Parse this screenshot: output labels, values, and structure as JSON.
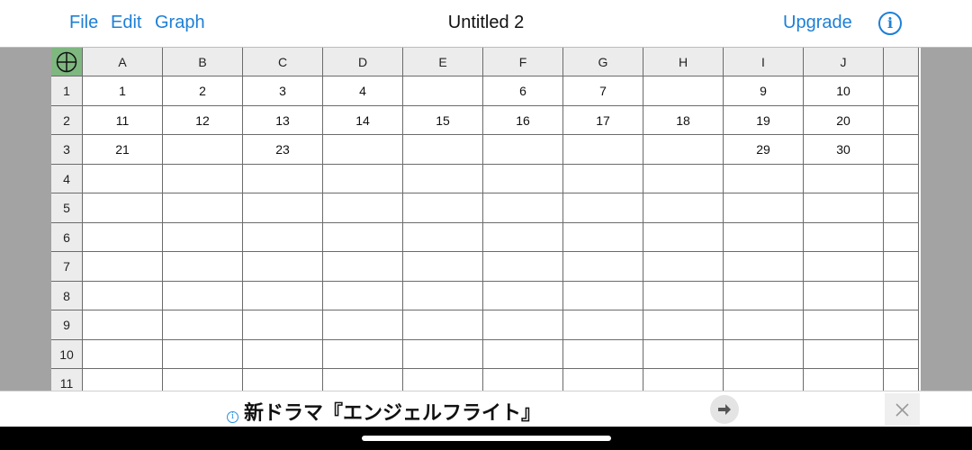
{
  "menu": {
    "file": "File",
    "edit": "Edit",
    "graph": "Graph"
  },
  "document": {
    "title": "Untitled 2"
  },
  "actions": {
    "upgrade": "Upgrade",
    "info_symbol": "i"
  },
  "spreadsheet": {
    "columns": [
      "A",
      "B",
      "C",
      "D",
      "E",
      "F",
      "G",
      "H",
      "I",
      "J",
      ""
    ],
    "row_numbers": [
      "1",
      "2",
      "3",
      "4",
      "5",
      "6",
      "7",
      "8",
      "9",
      "10",
      "11"
    ],
    "cells": [
      [
        "1",
        "2",
        "3",
        "4",
        "",
        "6",
        "7",
        "",
        "9",
        "10",
        ""
      ],
      [
        "11",
        "12",
        "13",
        "14",
        "15",
        "16",
        "17",
        "18",
        "19",
        "20",
        ""
      ],
      [
        "21",
        "",
        "23",
        "",
        "",
        "",
        "",
        "",
        "29",
        "30",
        ""
      ],
      [
        "",
        "",
        "",
        "",
        "",
        "",
        "",
        "",
        "",
        "",
        ""
      ],
      [
        "",
        "",
        "",
        "",
        "",
        "",
        "",
        "",
        "",
        "",
        ""
      ],
      [
        "",
        "",
        "",
        "",
        "",
        "",
        "",
        "",
        "",
        "",
        ""
      ],
      [
        "",
        "",
        "",
        "",
        "",
        "",
        "",
        "",
        "",
        "",
        ""
      ],
      [
        "",
        "",
        "",
        "",
        "",
        "",
        "",
        "",
        "",
        "",
        ""
      ],
      [
        "",
        "",
        "",
        "",
        "",
        "",
        "",
        "",
        "",
        "",
        ""
      ],
      [
        "",
        "",
        "",
        "",
        "",
        "",
        "",
        "",
        "",
        "",
        ""
      ],
      [
        "",
        "",
        "",
        "",
        "",
        "",
        "",
        "",
        "",
        "",
        ""
      ]
    ],
    "corner_icon": "crosshair-circle-icon"
  },
  "ad": {
    "info_symbol": "i",
    "text": "新ドラマ『エンジェルフライト』",
    "arrow_icon": "arrow-right-icon",
    "close_icon": "close-icon"
  },
  "colors": {
    "accent": "#1d7fd6",
    "corner_fill": "#7fb780",
    "header_fill": "#ececec",
    "side_gray": "#a3a3a3"
  }
}
